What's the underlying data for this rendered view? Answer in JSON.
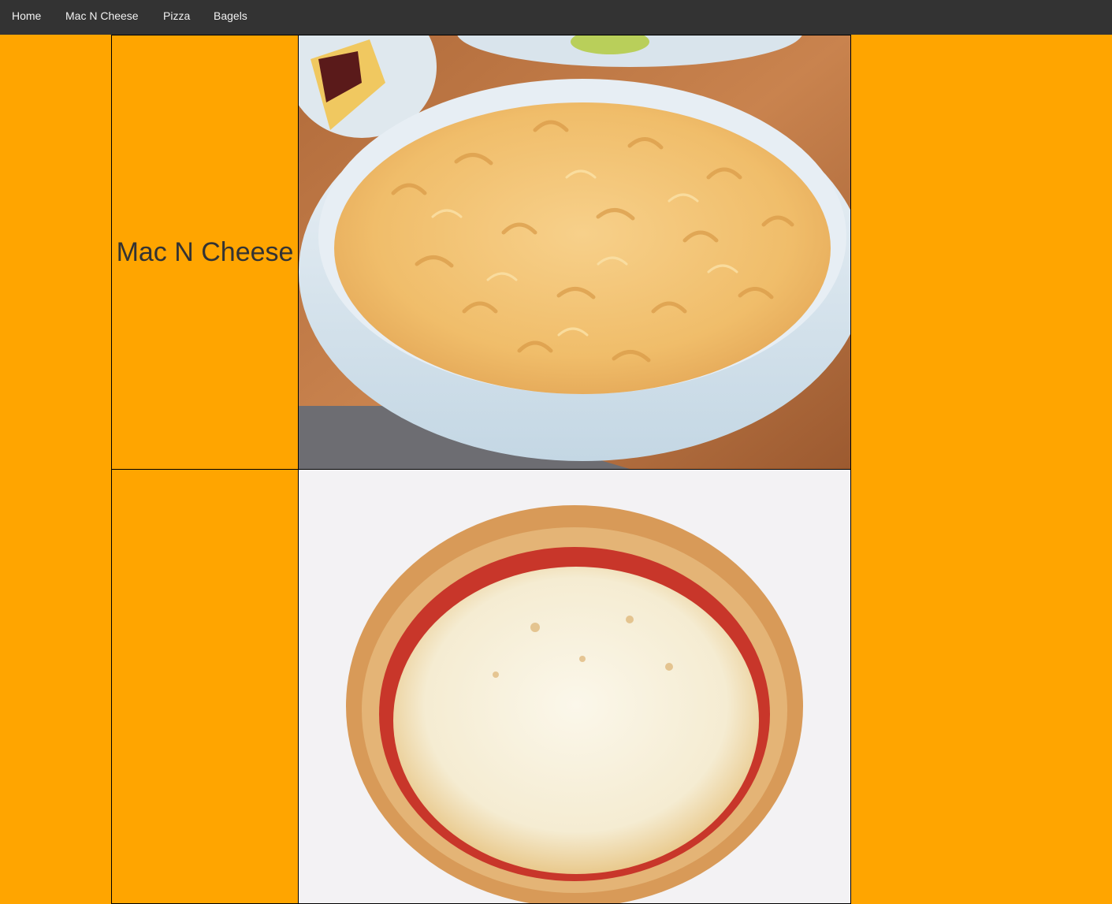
{
  "nav": {
    "items": [
      {
        "label": "Home"
      },
      {
        "label": "Mac N Cheese"
      },
      {
        "label": "Pizza"
      },
      {
        "label": "Bagels"
      }
    ]
  },
  "foods": [
    {
      "name": "Mac N Cheese",
      "image": "mac-n-cheese-bowl-photo"
    },
    {
      "name": "",
      "image": "cheese-pizza-photo"
    }
  ],
  "colors": {
    "page_background": "#FFA500",
    "nav_background": "#333333",
    "nav_text": "#f2f2f2",
    "heading_text": "#333333"
  }
}
